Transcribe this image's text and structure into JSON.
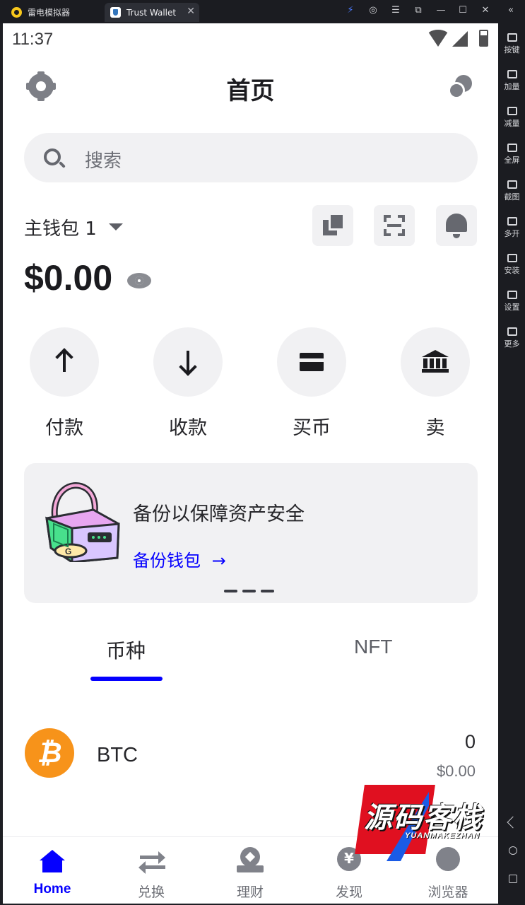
{
  "emulator": {
    "tabs": [
      {
        "label": "雷电模拟器"
      },
      {
        "label": "Trust Wallet"
      }
    ],
    "tab_close": "✕",
    "window_controls": [
      "⚡",
      "◎",
      "☰",
      "⧉",
      "—",
      "☐",
      "✕",
      "«"
    ],
    "toolbar": [
      {
        "label": "按键",
        "icon": "keyboard-icon"
      },
      {
        "label": "加量",
        "icon": "volume-up-icon"
      },
      {
        "label": "减量",
        "icon": "volume-down-icon"
      },
      {
        "label": "全屏",
        "icon": "fullscreen-icon"
      },
      {
        "label": "截图",
        "icon": "scissors-icon"
      },
      {
        "label": "多开",
        "icon": "multi-instance-icon"
      },
      {
        "label": "安装",
        "icon": "install-icon"
      },
      {
        "label": "设置",
        "icon": "settings-icon"
      },
      {
        "label": "更多",
        "icon": "more-icon"
      }
    ],
    "android_nav": [
      "back-icon",
      "home-circle-icon",
      "recents-icon"
    ]
  },
  "status_bar": {
    "time": "11:37"
  },
  "header": {
    "title": "首页"
  },
  "search": {
    "placeholder": "搜索"
  },
  "wallet": {
    "name": "主钱包 1",
    "balance": "$0.00"
  },
  "actions": [
    {
      "label": "付款",
      "icon": "arrow-up-icon"
    },
    {
      "label": "收款",
      "icon": "arrow-down-icon"
    },
    {
      "label": "买币",
      "icon": "card-icon"
    },
    {
      "label": "卖",
      "icon": "bank-icon"
    }
  ],
  "banner": {
    "title": "备份以保障资产安全",
    "link": "备份钱包",
    "link_arrow": "→"
  },
  "tabs": {
    "tokens": "币种",
    "nft": "NFT"
  },
  "assets": [
    {
      "logo": "₿",
      "symbol": "BTC",
      "amount": "0",
      "value": "$0.00"
    }
  ],
  "bottom_nav": [
    {
      "label": "Home",
      "icon": "home-icon",
      "active": true
    },
    {
      "label": "兑换",
      "icon": "swap-icon",
      "active": false
    },
    {
      "label": "理财",
      "icon": "earn-icon",
      "active": false
    },
    {
      "label": "发现",
      "icon": "discover-icon",
      "active": false
    },
    {
      "label": "浏览器",
      "icon": "browser-icon",
      "active": false
    }
  ],
  "watermark": {
    "text": "源码客栈",
    "sub": "YUANMAKEZHAN"
  },
  "colors": {
    "accent": "#0500ff",
    "btc": "#f7931a",
    "surface": "#f1f1f3"
  }
}
